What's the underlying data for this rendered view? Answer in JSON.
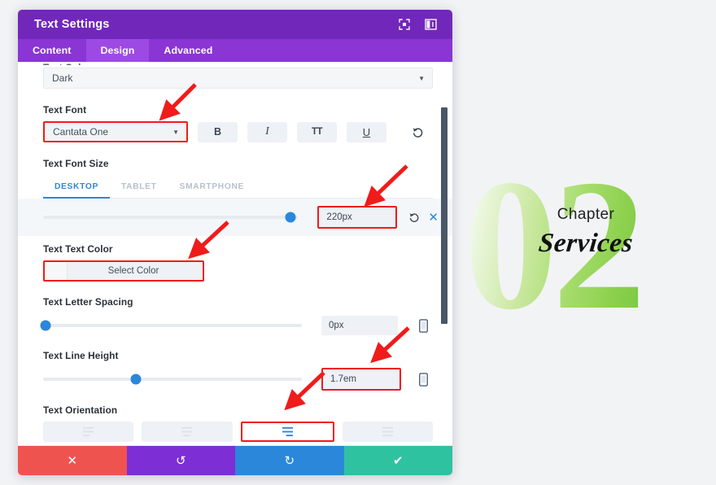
{
  "panel": {
    "title": "Text Settings",
    "header_icons": [
      {
        "name": "focus-icon",
        "glyph": "focus"
      },
      {
        "name": "panel-layout-icon",
        "glyph": "layout"
      }
    ],
    "tabs": [
      {
        "label": "Content",
        "active": false
      },
      {
        "label": "Design",
        "active": true
      },
      {
        "label": "Advanced",
        "active": false
      }
    ]
  },
  "fields": {
    "text_color": {
      "label": "Text Color",
      "value": "Dark",
      "caret": "▼"
    },
    "text_font": {
      "label": "Text Font",
      "value": "Cantata One",
      "caret": "▼",
      "style_buttons": [
        {
          "name": "bold-button",
          "label": "B"
        },
        {
          "name": "italic-button",
          "label": "I"
        },
        {
          "name": "uppercase-button",
          "label": "TT"
        },
        {
          "name": "underline-button",
          "label": "U"
        }
      ],
      "reset_icon": "undo-reset-icon"
    },
    "text_font_size": {
      "label": "Text Font Size",
      "device_tabs": [
        {
          "label": "DESKTOP",
          "active": true
        },
        {
          "label": "TABLET",
          "active": false
        },
        {
          "label": "SMARTPHONE",
          "active": false
        }
      ],
      "value": "220px",
      "slider_percent": 97,
      "reset_icon": "undo-reset-icon",
      "clear_icon": "close-icon"
    },
    "text_text_color": {
      "label": "Text Text Color",
      "button_label": "Select Color",
      "swatch_color": "#f6f7f8"
    },
    "text_letter_spacing": {
      "label": "Text Letter Spacing",
      "value": "0px",
      "slider_percent": 1,
      "device_icon": "mobile-icon"
    },
    "text_line_height": {
      "label": "Text Line Height",
      "value": "1.7em",
      "slider_percent": 36,
      "device_icon": "mobile-icon"
    },
    "text_orientation": {
      "label": "Text Orientation",
      "options": [
        {
          "name": "align-left-button",
          "active": false,
          "highlighted": false
        },
        {
          "name": "align-center-button",
          "active": false,
          "highlighted": false
        },
        {
          "name": "align-right-button",
          "active": true,
          "highlighted": true
        },
        {
          "name": "align-justify-button",
          "active": false,
          "highlighted": false
        }
      ]
    }
  },
  "footer": {
    "buttons": [
      {
        "name": "cancel-button",
        "glyph": "✕",
        "color": "#ef5350"
      },
      {
        "name": "undo-button",
        "glyph": "↺",
        "color": "#7d2ed4"
      },
      {
        "name": "redo-button",
        "glyph": "↻",
        "color": "#2b87da"
      },
      {
        "name": "save-button",
        "glyph": "✔",
        "color": "#2fc2a0"
      }
    ]
  },
  "preview": {
    "number": "02",
    "chapter_label": "Chapter",
    "title": "Services",
    "gradient_from": "#ffffff",
    "gradient_to": "#7bc943"
  },
  "annotations": {
    "color": "#f01b1b",
    "arrow_count": 4
  }
}
